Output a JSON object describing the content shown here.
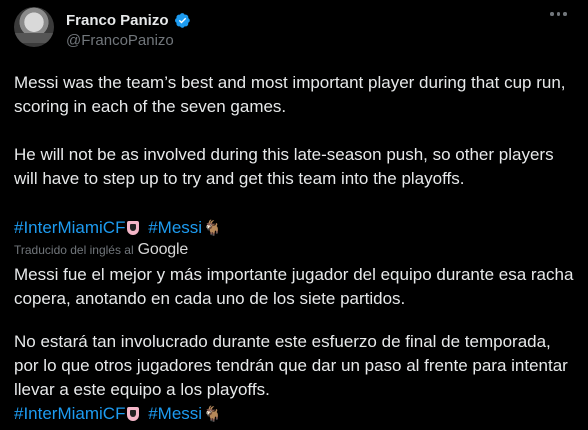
{
  "author": {
    "display_name": "Franco Panizo",
    "handle": "@FrancoPanizo",
    "verified": true
  },
  "tweet": {
    "paragraph_1": "Messi was the team’s best and most important player during that cup run, scoring in each of the seven games.",
    "paragraph_2": "He will not be as involved during this late-season push, so other players will have to step up to try and get this team into the playoffs.",
    "hashtag_1": "#InterMiamiCF",
    "hashtag_2": "#Messi",
    "emoji_1": "pink-crest-emoji",
    "emoji_2": "goat-emoji"
  },
  "translation": {
    "label": "Traducido del inglés al",
    "provider": "Google",
    "paragraph_1": "Messi fue el mejor y más importante jugador del equipo durante esa racha copera, anotando en cada uno de los siete partidos.",
    "paragraph_2": "No estará tan involucrado durante este esfuerzo de final de temporada, por lo que otros jugadores tendrán que dar un paso al frente para intentar llevar a este equipo a los playoffs.",
    "hashtag_1": "#InterMiamiCF",
    "hashtag_2": "#Messi"
  },
  "colors": {
    "background": "#000000",
    "text": "#e7e9ea",
    "secondary": "#71767b",
    "link": "#1d9bf0",
    "verified": "#1d9bf0"
  }
}
